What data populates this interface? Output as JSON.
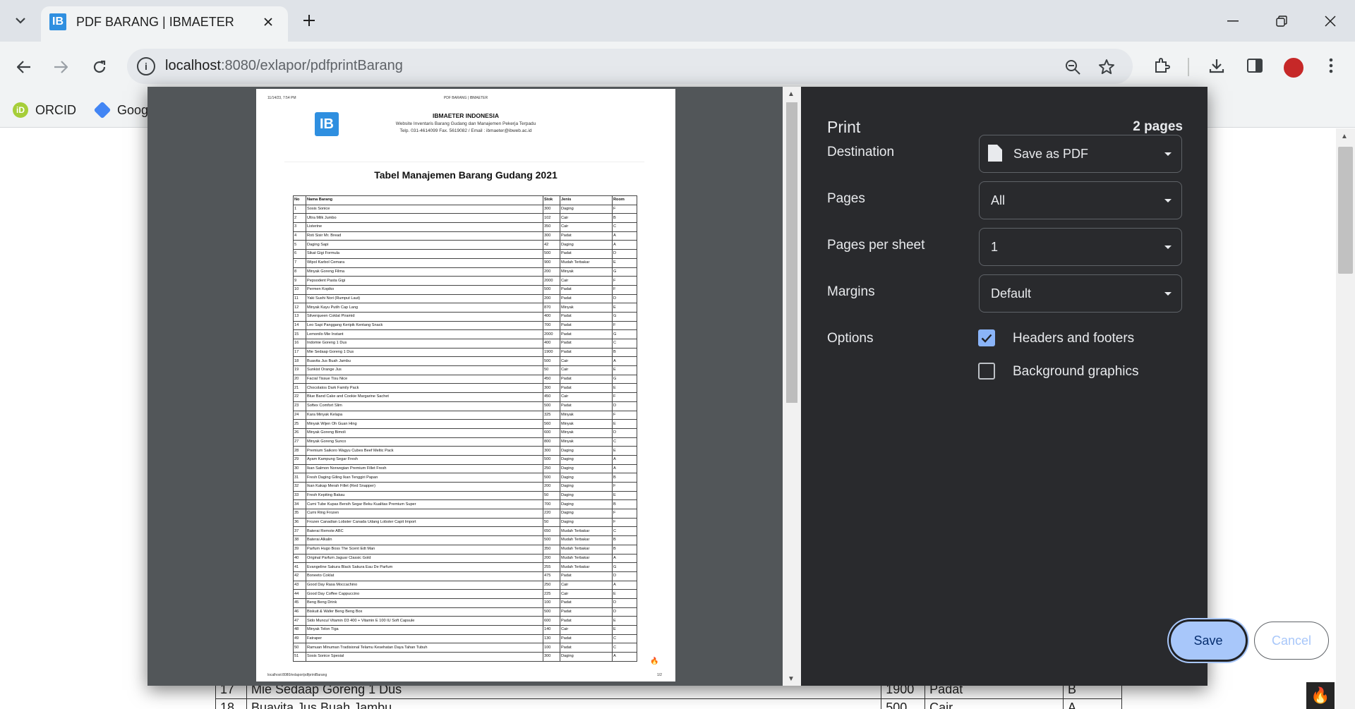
{
  "browser": {
    "tab_title": "PDF BARANG | IBMAETER",
    "tab_favicon": "IB",
    "url_host": "localhost",
    "url_path": ":8080/exlapor/pdfprintBarang",
    "bookmarks": [
      {
        "label": "ORCID",
        "icon": "orcid-icon",
        "color": "#a6ce39"
      },
      {
        "label": "Goog",
        "icon": "drive-icon",
        "color": "#4285f4"
      }
    ]
  },
  "background_rows": [
    {
      "no": "17",
      "nama": "Mie Sedaap Goreng 1 Dus",
      "stok": "1900",
      "jenis": "Padat",
      "room": "B"
    },
    {
      "no": "18",
      "nama": "Buavita Jus Buah Jambu",
      "stok": "500",
      "jenis": "Cair",
      "room": "A"
    }
  ],
  "preview": {
    "header_date": "11/14/23, 7:54 PM",
    "header_title": "PDF BARANG | IBMAETER",
    "logo_text": "IB",
    "company_name": "IBMAETER INDONESIA",
    "company_line1": "Website Inventaris Barang Gudang dan Manajemen Pekerja Terpadu",
    "company_line2": "Telp. 031-4614099 Fax. 5619082 / Email : ibmaeter@ibweb.ac.id",
    "heading": "Tabel Manajemen Barang Gudang 2021",
    "columns": [
      "No",
      "Nama Barang",
      "Stok",
      "Jenis",
      "Room"
    ],
    "rows": [
      [
        "1",
        "Sosis Sonice",
        "300",
        "Daging",
        "F"
      ],
      [
        "2",
        "Ultra Milk Jumbo",
        "102",
        "Cair",
        "B"
      ],
      [
        "3",
        "Listerine",
        "350",
        "Cair",
        "C"
      ],
      [
        "4",
        "Roti Sisir Mr. Bread",
        "300",
        "Padat",
        "A"
      ],
      [
        "5",
        "Daging Sapi",
        "42",
        "Daging",
        "A"
      ],
      [
        "6",
        "Sikat Gigi Formula",
        "500",
        "Padat",
        "D"
      ],
      [
        "7",
        "Wipol Karbol Cemara",
        "900",
        "Mudah Terbakar",
        "E"
      ],
      [
        "8",
        "Minyak Goreng Filma",
        "200",
        "Minyak",
        "G"
      ],
      [
        "9",
        "Pepsodent Pasta Gigi",
        "2000",
        "Cair",
        "F"
      ],
      [
        "10",
        "Permen Kopiko",
        "500",
        "Padat",
        "F"
      ],
      [
        "11",
        "Yaki Sushi Nori (Rumput Laut)",
        "200",
        "Padat",
        "D"
      ],
      [
        "12",
        "Minyak Kayu Putih Cap Lang",
        "870",
        "Minyak",
        "E"
      ],
      [
        "13",
        "Silverqueen Coklat Piramid",
        "400",
        "Padat",
        "G"
      ],
      [
        "14",
        "Leo Sapi Panggang Keripik Kentang Snack",
        "700",
        "Padat",
        "F"
      ],
      [
        "15",
        "Lemonilo Mie Instant",
        "2000",
        "Padat",
        "G"
      ],
      [
        "16",
        "Indomie Goreng 1 Dus",
        "400",
        "Padat",
        "C"
      ],
      [
        "17",
        "Mie Sedaap Goreng 1 Dus",
        "1900",
        "Padat",
        "B"
      ],
      [
        "18",
        "Buavita Jus Buah Jambu",
        "500",
        "Cair",
        "A"
      ],
      [
        "19",
        "Sunkist Orange Jus",
        "50",
        "Cair",
        "E"
      ],
      [
        "20",
        "Facial Tissue Tisu Nice",
        "450",
        "Padat",
        "G"
      ],
      [
        "21",
        "Chocolatos Dark Family Pack",
        "300",
        "Padat",
        "E"
      ],
      [
        "22",
        "Blue Band Cake and Cookie Margarine Sachet",
        "450",
        "Cair",
        "F"
      ],
      [
        "23",
        "Softex Comfort Slim",
        "500",
        "Padat",
        "D"
      ],
      [
        "24",
        "Kara Minyak Kelapa",
        "325",
        "Minyak",
        "F"
      ],
      [
        "25",
        "Minyak Wijen Oh Guan Hing",
        "560",
        "Minyak",
        "E"
      ],
      [
        "26",
        "Minyak Goreng Bimoli",
        "600",
        "Minyak",
        "D"
      ],
      [
        "27",
        "Minyak Goreng Sunco",
        "800",
        "Minyak",
        "C"
      ],
      [
        "28",
        "Premium Saikoro Wagyu Cubes Beef Meltic Pack",
        "300",
        "Daging",
        "E"
      ],
      [
        "29",
        "Ayam Kampung Segar Fresh",
        "500",
        "Daging",
        "A"
      ],
      [
        "30",
        "Ikan Salmon Norwegian Premium Fillet Fresh",
        "250",
        "Daging",
        "A"
      ],
      [
        "31",
        "Fresh Daging Giling Ikan Tenggiri Papan",
        "500",
        "Daging",
        "B"
      ],
      [
        "32",
        "Ikan Kakap Merah Fillet (Red Snapper)",
        "200",
        "Daging",
        "F"
      ],
      [
        "33",
        "Fresh Kepiting Bakau",
        "50",
        "Daging",
        "E"
      ],
      [
        "34",
        "Cumi Tube Kupas Bersih Segar Beku Kualitas Premium Super",
        "700",
        "Daging",
        "B"
      ],
      [
        "35",
        "Cumi Ring Frozen",
        "220",
        "Daging",
        "F"
      ],
      [
        "36",
        "Frozen Canadian Lobster Canada Udang Lobster Capit Import",
        "50",
        "Daging",
        "F"
      ],
      [
        "37",
        "Baterai Remote ABC",
        "650",
        "Mudah Terbakar",
        "C"
      ],
      [
        "38",
        "Baterai Alkalin",
        "500",
        "Mudah Terbakar",
        "B"
      ],
      [
        "39",
        "Parfum Hugo Boss The Scent Edt Man",
        "350",
        "Mudah Terbakar",
        "B"
      ],
      [
        "40",
        "Original Parfum Jaguar Classic Gold",
        "200",
        "Mudah Terbakar",
        "A"
      ],
      [
        "41",
        "Evangeline Sakura Black Sakura Eau De Parfum",
        "255",
        "Mudah Terbakar",
        "G"
      ],
      [
        "42",
        "Boneeto Coklat",
        "475",
        "Padat",
        "D"
      ],
      [
        "43",
        "Good Day Rasa Moccachino",
        "250",
        "Cair",
        "A"
      ],
      [
        "44",
        "Good Day Coffee Cappuccino",
        "225",
        "Cair",
        "E"
      ],
      [
        "45",
        "Beng Beng Drink",
        "100",
        "Padat",
        "D"
      ],
      [
        "46",
        "Biskuit & Wafer Beng Beng Box",
        "500",
        "Padat",
        "D"
      ],
      [
        "47",
        "Sido Muncul Vitamin D3 400 + Vitamin E 100 IU Soft Capsule",
        "600",
        "Padat",
        "E"
      ],
      [
        "48",
        "Minyak Telon Tiga",
        "140",
        "Cair",
        "E"
      ],
      [
        "49",
        "Fatraper",
        "130",
        "Padat",
        "C"
      ],
      [
        "50",
        "Ramuan Minuman Tradisional Telamu Kesehatan Daya Tahan Tubuh",
        "100",
        "Padat",
        "C"
      ],
      [
        "51",
        "Sosis Sonice Spesial",
        "300",
        "Daging",
        "A"
      ]
    ],
    "footer_url": "localhost:8080/exlapor/pdfprintBarang",
    "footer_page": "1/2"
  },
  "print": {
    "title": "Print",
    "page_count": "2 pages",
    "destination_label": "Destination",
    "destination_value": "Save as PDF",
    "pages_label": "Pages",
    "pages_value": "All",
    "pps_label": "Pages per sheet",
    "pps_value": "1",
    "margins_label": "Margins",
    "margins_value": "Default",
    "options_label": "Options",
    "opt_headers": "Headers and footers",
    "opt_headers_checked": true,
    "opt_background": "Background graphics",
    "opt_background_checked": false,
    "save_label": "Save",
    "cancel_label": "Cancel"
  }
}
